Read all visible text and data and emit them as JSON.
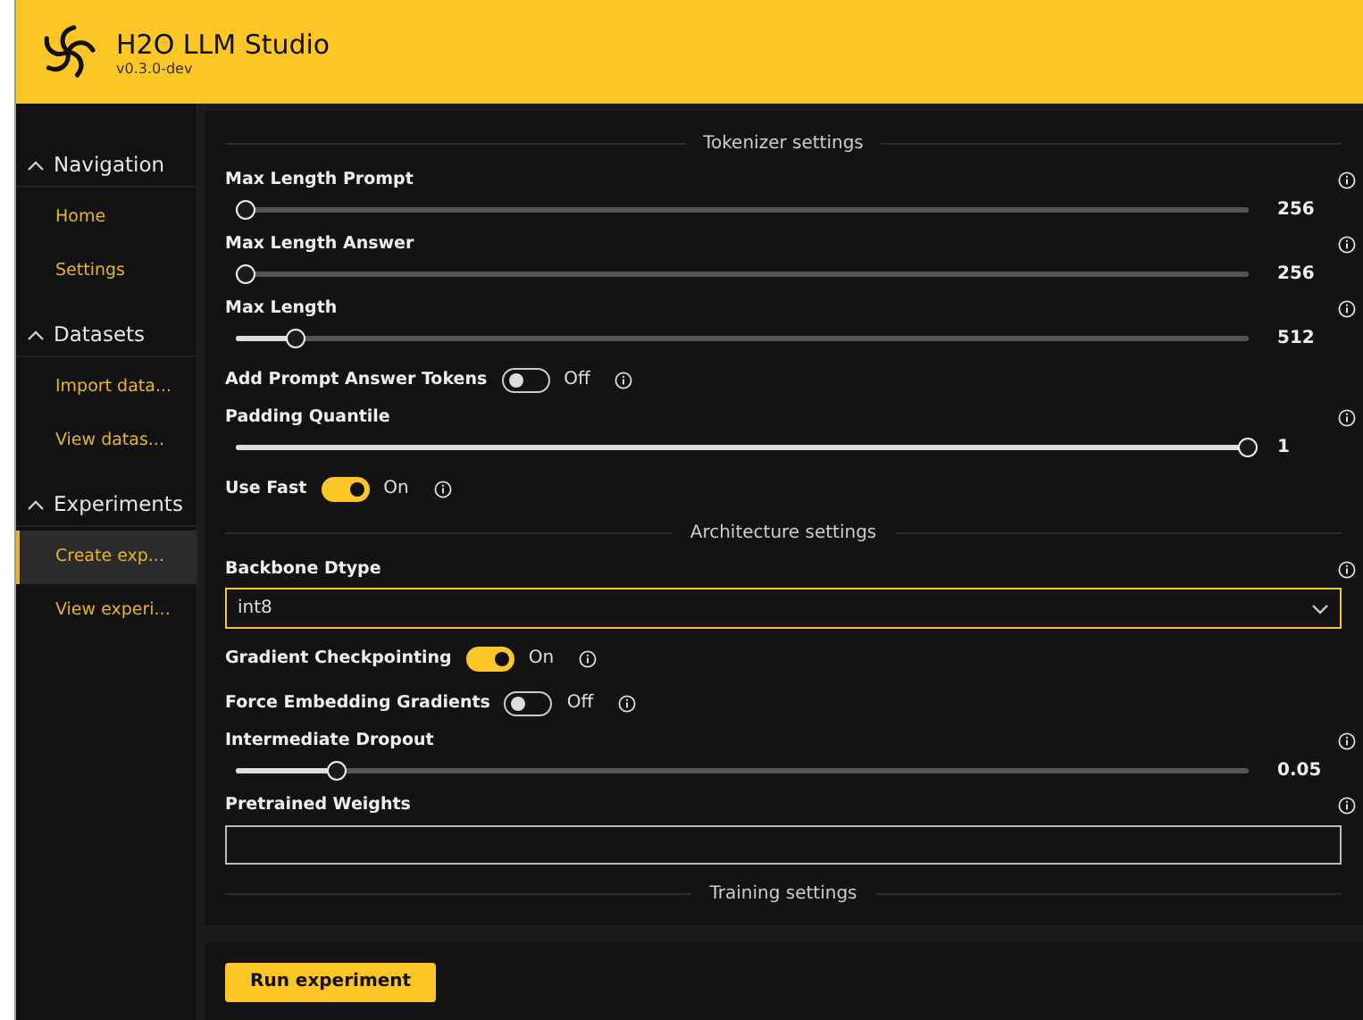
{
  "app": {
    "title": "H2O LLM Studio",
    "version": "v0.3.0-dev"
  },
  "sidebar": [
    {
      "title": "Navigation",
      "expanded": true,
      "items": [
        {
          "label": "Home",
          "selected": false
        },
        {
          "label": "Settings",
          "selected": false
        }
      ]
    },
    {
      "title": "Datasets",
      "expanded": true,
      "items": [
        {
          "label": "Import data...",
          "selected": false
        },
        {
          "label": "View datas...",
          "selected": false
        }
      ]
    },
    {
      "title": "Experiments",
      "expanded": true,
      "items": [
        {
          "label": "Create exp...",
          "selected": true
        },
        {
          "label": "View experi...",
          "selected": false
        }
      ]
    }
  ],
  "settings": [
    {
      "kind": "section",
      "title": "Tokenizer settings"
    },
    {
      "kind": "slider",
      "label": "Max Length Prompt",
      "level": 0.01,
      "reading": "256"
    },
    {
      "kind": "slider",
      "label": "Max Length Answer",
      "level": 0.01,
      "reading": "256"
    },
    {
      "kind": "slider",
      "label": "Max Length",
      "level": 0.06,
      "reading": "512"
    },
    {
      "kind": "toggle",
      "label": "Add Prompt Answer Tokens",
      "on": false,
      "state_text": "Off"
    },
    {
      "kind": "slider",
      "label": "Padding Quantile",
      "level": 1,
      "reading": "1"
    },
    {
      "kind": "toggle",
      "label": "Use Fast",
      "on": true,
      "state_text": "On"
    },
    {
      "kind": "section",
      "title": "Architecture settings"
    },
    {
      "kind": "dropdown",
      "label": "Backbone Dtype",
      "value": "int8"
    },
    {
      "kind": "toggle",
      "label": "Gradient Checkpointing",
      "on": true,
      "state_text": "On"
    },
    {
      "kind": "toggle",
      "label": "Force Embedding Gradients",
      "on": false,
      "state_text": "Off"
    },
    {
      "kind": "slider",
      "label": "Intermediate Dropout",
      "level": 0.1,
      "reading": "0.05"
    },
    {
      "kind": "textfield",
      "label": "Pretrained Weights"
    },
    {
      "kind": "section",
      "title": "Training settings"
    }
  ],
  "run_button": "Run experiment"
}
